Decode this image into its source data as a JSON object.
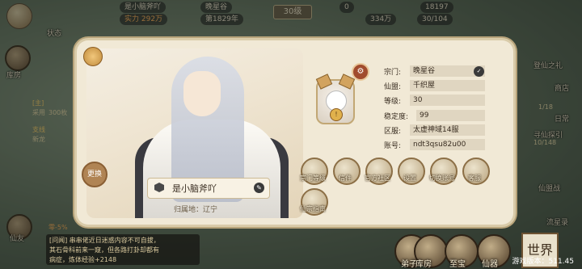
{
  "topbar": {
    "player_name": "是小脑斧吖",
    "power": "实力 292万",
    "sect": "晚星谷",
    "era": "第1829年",
    "level": "30级",
    "currency1": "0",
    "currency2": "18197",
    "currency3": "334万",
    "stamina": "30/104"
  },
  "left_side": {
    "status_label": "状态",
    "library_label": "库房",
    "task_label": "[主]",
    "task_text": "采用",
    "task_count": "300枚",
    "branch_label": "支线",
    "branch_text": "新龙",
    "friend_label": "仙友",
    "percent_text": "零-5%"
  },
  "card": {
    "player_name": "是小脑斧吖",
    "home_label": "归属地：辽宁",
    "stamp_label": "更换",
    "fields": [
      {
        "key": "宗门:",
        "value": "晚星谷"
      },
      {
        "key": "仙盟:",
        "value": "千织屋"
      },
      {
        "key": "等级:",
        "value": "30"
      },
      {
        "key": "稳定度:",
        "value": "99"
      },
      {
        "key": "区服:",
        "value": "太虚神域14服"
      },
      {
        "key": "账号:",
        "value": "ndt3qsu82u00"
      }
    ],
    "buttons": [
      {
        "label": "宗门等级",
        "icon": "sect-rank-icon"
      },
      {
        "label": "信件",
        "icon": "mail-icon"
      },
      {
        "label": "官方社区",
        "icon": "community-icon"
      },
      {
        "label": "设置",
        "icon": "settings-icon"
      },
      {
        "label": "切换账号",
        "icon": "switch-account-icon"
      },
      {
        "label": "客服",
        "icon": "customer-service-icon"
      },
      {
        "label": "仙宗指南",
        "icon": "guide-icon"
      }
    ]
  },
  "right_side": {
    "items": [
      "登仙之礼",
      "商店",
      "日常",
      "寻仙探引",
      "仙盟战",
      "流星录"
    ],
    "counts": [
      "1/18",
      "10/148"
    ]
  },
  "chat": {
    "line1": "[问闻] 串串佬近日迷惑内容不可自拔，",
    "line2": "其石骨科前来一窥，但各路打卦却都有",
    "line3": "病症，炼体经验+2148"
  },
  "bottom": {
    "items": [
      "弟子",
      "库房",
      "至宝",
      "仙器"
    ],
    "world_label": "世界",
    "version": "游戏版本：511.45"
  }
}
